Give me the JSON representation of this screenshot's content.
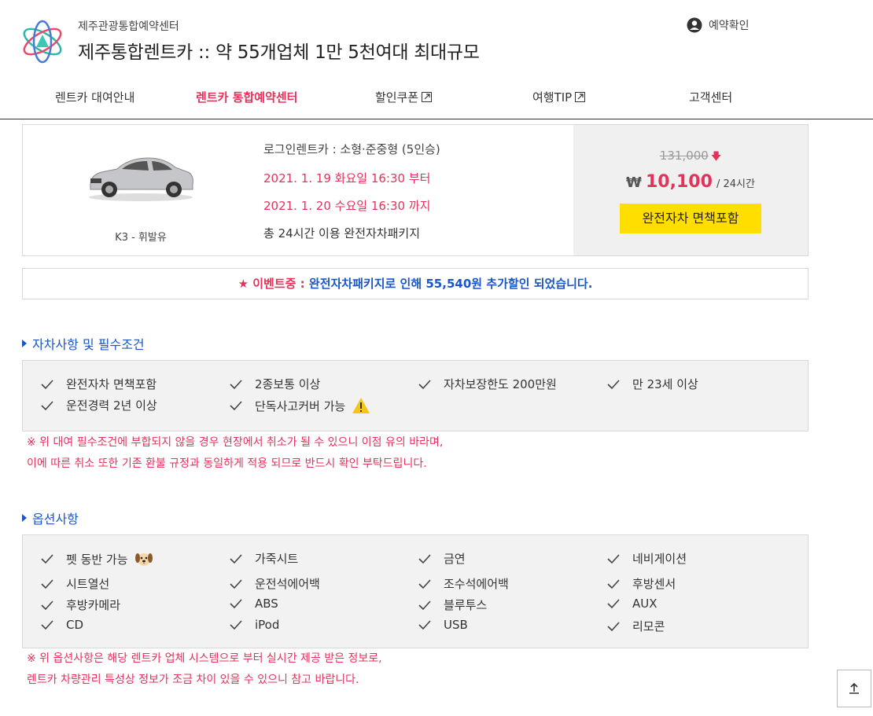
{
  "header": {
    "subtitle": "제주관광통합예약센터",
    "title": "제주통합렌트카 :: 약 55개업체 1만 5천여대 최대규모",
    "reserve_check": "예약확인"
  },
  "nav": [
    {
      "label": "렌트카 대여안내",
      "active": false,
      "external": false
    },
    {
      "label": "렌트카 통합예약센터",
      "active": true,
      "external": false
    },
    {
      "label": "할인쿠폰",
      "active": false,
      "external": true
    },
    {
      "label": "여행TIP",
      "active": false,
      "external": true
    },
    {
      "label": "고객센터",
      "active": false,
      "external": false
    }
  ],
  "car": {
    "name": "K3 - 휘발유",
    "company": "로그인렌트카 : 소형·준중형 (5인승)",
    "start": "2021. 1. 19 화요일 16:30 부터",
    "end": "2021. 1. 20 수요일 16:30 까지",
    "total": "총 24시간 이용 완전자차패키지",
    "original_price": "131,000",
    "currency": "₩",
    "price": "10,100",
    "per": "/ 24시간",
    "badge": "완전자차 면책포함"
  },
  "event": {
    "star": "★",
    "prefix": "이벤트중 :",
    "text1": "완전자차패키지로 인해",
    "amount": "55,540원",
    "text2": "추가할인 되었습니다."
  },
  "conditions": {
    "title": "자차사항 및 필수조건",
    "items": [
      "완전자차 면책포함",
      "2종보통 이상",
      "자차보장한도 200만원",
      "만 23세 이상",
      "운전경력 2년 이상",
      "단독사고커버 가능"
    ],
    "notice": [
      "※ 위 대여 필수조건에 부합되지 않을 경우 현장에서 취소가 될 수 있으니 이점 유의 바라며,",
      "이에 따른 취소 또한 기존 환불 규정과 동일하게 적용 되므로 반드시 확인 부탁드립니다."
    ]
  },
  "options": {
    "title": "옵션사항",
    "items": [
      "펫 동반 가능",
      "가죽시트",
      "금연",
      "네비게이션",
      "시트열선",
      "운전석에어백",
      "조수석에어백",
      "후방센서",
      "후방카메라",
      "ABS",
      "블루투스",
      "AUX",
      "CD",
      "iPod",
      "USB",
      "리모콘"
    ],
    "notice": [
      "※ 위 옵션사항은 해당 렌트카 업체 시스템으로 부터 실시간 제공 받은 정보로,",
      "렌트카 차량관리 특성상 정보가 조금 차이 있을 수 있으니 참고 바랍니다."
    ]
  },
  "colors": {
    "accent_pink": "#e5325b",
    "accent_blue": "#1a56c8",
    "badge_yellow": "#ffde00"
  }
}
